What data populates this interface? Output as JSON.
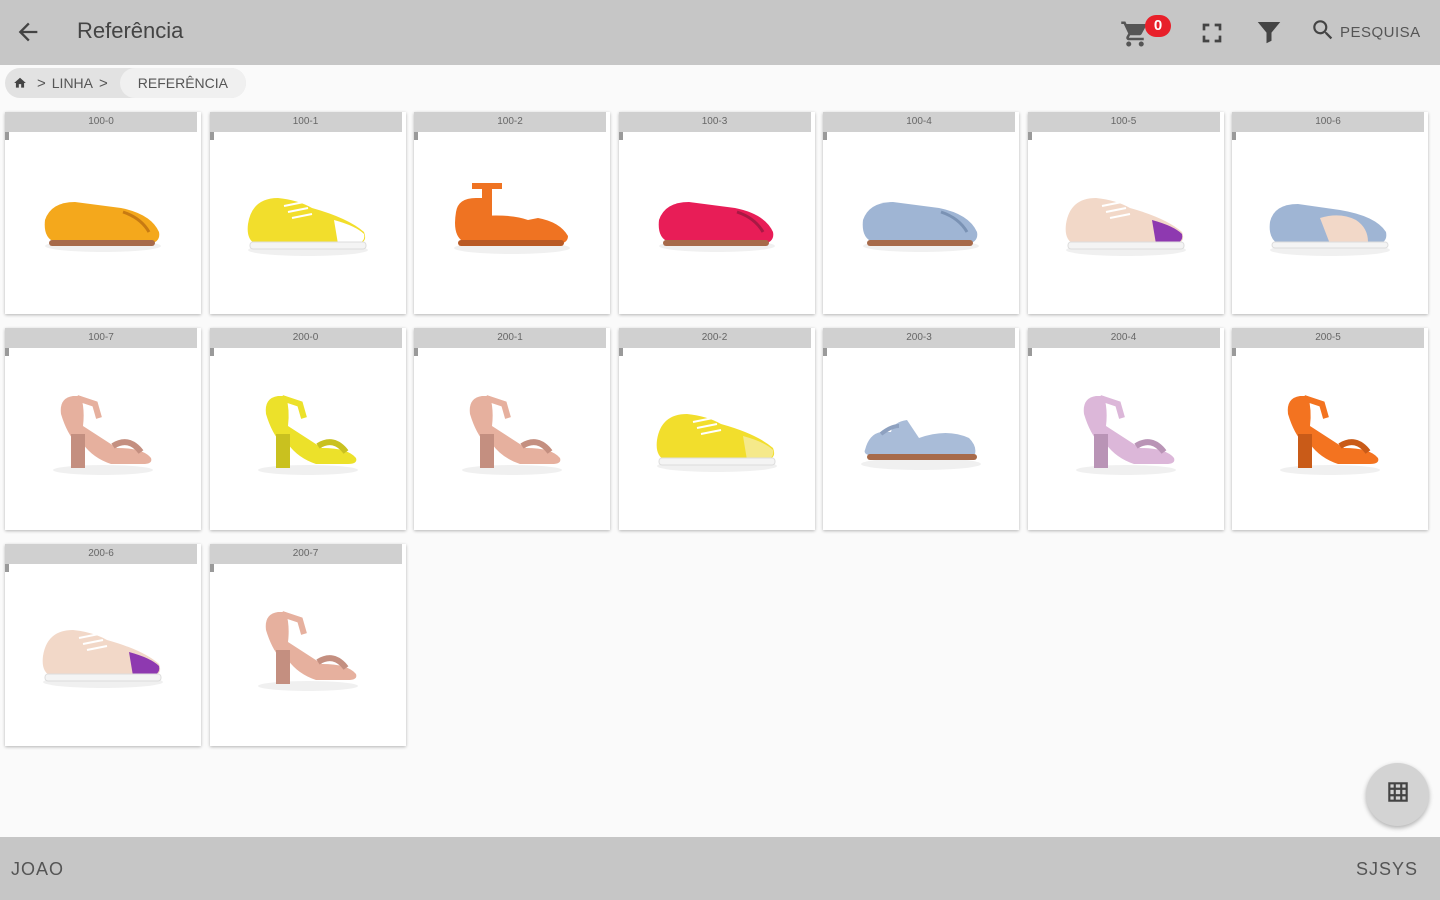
{
  "header": {
    "title": "Referência",
    "cart_count": "0",
    "search_label": "PESQUISA"
  },
  "breadcrumb": {
    "items": [
      "LINHA"
    ],
    "current": "REFERÊNCIA"
  },
  "products": [
    {
      "ref": "100-0",
      "type": "flat",
      "color": "#f4a81c",
      "accent": "#c77a12"
    },
    {
      "ref": "100-1",
      "type": "sneaker",
      "color": "#f2de2c",
      "accent": "#ffffff"
    },
    {
      "ref": "100-2",
      "type": "tstrap",
      "color": "#ef7322",
      "accent": "#b95a25"
    },
    {
      "ref": "100-3",
      "type": "flat",
      "color": "#e81d57",
      "accent": "#a81944"
    },
    {
      "ref": "100-4",
      "type": "flat",
      "color": "#9fb5d4",
      "accent": "#7a92b4"
    },
    {
      "ref": "100-5",
      "type": "sneaker",
      "color": "#f2d8c8",
      "accent": "#8e39b0"
    },
    {
      "ref": "100-6",
      "type": "slipon",
      "color": "#9fb5d4",
      "accent": "#f2d8c8"
    },
    {
      "ref": "100-7",
      "type": "heel",
      "color": "#e6b09e",
      "accent": "#c48f80"
    },
    {
      "ref": "200-0",
      "type": "heel",
      "color": "#ece12a",
      "accent": "#c9c11f"
    },
    {
      "ref": "200-1",
      "type": "heel",
      "color": "#e6b09e",
      "accent": "#c48f80"
    },
    {
      "ref": "200-2",
      "type": "sneaker",
      "color": "#f2de2c",
      "accent": "#f5e98a"
    },
    {
      "ref": "200-3",
      "type": "sandal",
      "color": "#a9bcd8",
      "accent": "#8ea1c0"
    },
    {
      "ref": "200-4",
      "type": "heel",
      "color": "#dcb7d9",
      "accent": "#b994b6"
    },
    {
      "ref": "200-5",
      "type": "heel",
      "color": "#f37320",
      "accent": "#c95b18"
    },
    {
      "ref": "200-6",
      "type": "sneaker",
      "color": "#f2d8c8",
      "accent": "#8e39b0"
    },
    {
      "ref": "200-7",
      "type": "heel",
      "color": "#e6b09e",
      "accent": "#c48f80"
    }
  ],
  "footer": {
    "user": "JOAO",
    "company": "SJSYS"
  },
  "colors": {
    "toolbar": "#c6c6c6",
    "badge": "#e8202a"
  }
}
